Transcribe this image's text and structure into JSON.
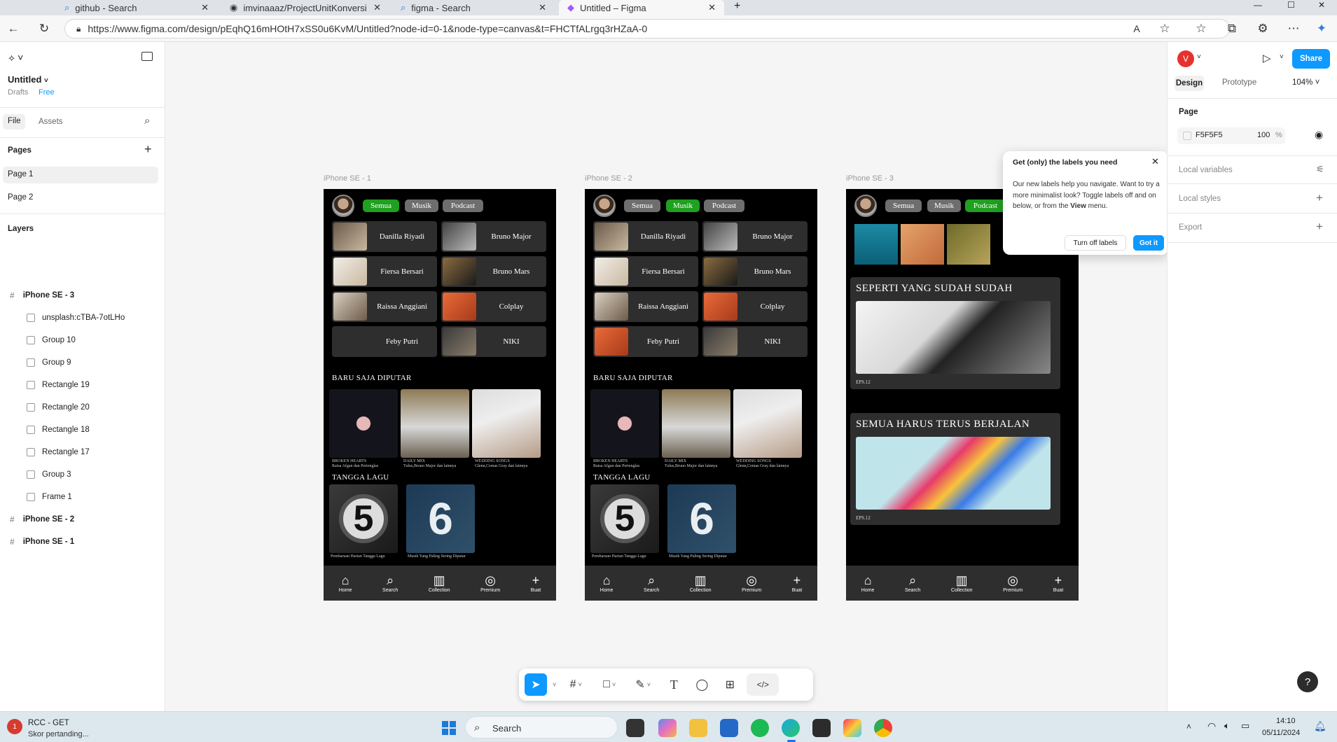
{
  "browser": {
    "tabs": [
      {
        "label": "github - Search"
      },
      {
        "label": "imvinaaaz/ProjectUnitKonversi"
      },
      {
        "label": "figma - Search"
      },
      {
        "label": "Untitled – Figma"
      }
    ],
    "url": "https://www.figma.com/design/pEqhQ16mHOtH7xSS0u6KvM/Untitled?node-id=0-1&node-type=canvas&t=FHCTfALrgq3rHZaA-0"
  },
  "file": {
    "name": "Untitled",
    "location": "Drafts",
    "plan": "Free"
  },
  "left": {
    "tabs": [
      "File",
      "Assets"
    ],
    "pages_title": "Pages",
    "pages": [
      "Page 1",
      "Page 2"
    ],
    "layers_title": "Layers",
    "layers": [
      {
        "name": "iPhone SE - 3",
        "bold": true
      },
      {
        "name": "unsplash:cTBA-7otLHo"
      },
      {
        "name": "Group 10"
      },
      {
        "name": "Group 9"
      },
      {
        "name": "Rectangle 19"
      },
      {
        "name": "Rectangle 20"
      },
      {
        "name": "Rectangle 18"
      },
      {
        "name": "Rectangle 17"
      },
      {
        "name": "Group 3"
      },
      {
        "name": "Frame 1"
      },
      {
        "name": "iPhone SE - 2",
        "bold": true
      },
      {
        "name": "iPhone SE - 1",
        "bold": true
      }
    ]
  },
  "right": {
    "avatar_letter": "V",
    "share": "Share",
    "tabs": [
      "Design",
      "Prototype"
    ],
    "zoom": "104%",
    "page_label": "Page",
    "page_color": "F5F5F5",
    "page_opacity": "100",
    "percent": "%",
    "sections": [
      "Local variables",
      "Local styles",
      "Export"
    ]
  },
  "frames": [
    {
      "label": "iPhone SE - 1",
      "active_chip": 0
    },
    {
      "label": "iPhone SE - 2",
      "active_chip": 1
    },
    {
      "label": "iPhone SE - 3",
      "active_chip": 2
    }
  ],
  "phone": {
    "chips": [
      "Semua",
      "Musik",
      "Podcast"
    ],
    "artists_v1": [
      "Danilla Riyadi",
      "Bruno Major",
      "Fiersa Bersari",
      "Bruno Mars",
      "Raissa Anggiani",
      "Colplay",
      "Feby Putri",
      "NIKI"
    ],
    "recent_title": "BARU SAJA DIPUTAR",
    "recent": [
      {
        "title": "BROKEN HEARTS",
        "sub": "Raisa Afgan dan Pertenglas"
      },
      {
        "title": "DAILY MIX",
        "sub": "Tulus,Bruno Major dan lainnya"
      },
      {
        "title": "WEDDING SONGS",
        "sub": "Glenn,Cemas Gray dan lainnya"
      }
    ],
    "charts_title": "TANGGA LAGU",
    "charts": [
      {
        "num": "5",
        "cap": "Pembaruan Harian Tangga Lagu"
      },
      {
        "num": "6",
        "cap": "Musik Yang Paling Sering Diputar"
      }
    ],
    "nav": [
      "Home",
      "Search",
      "Collection",
      "Premium",
      "Buat"
    ],
    "podcasts": [
      {
        "title": "SEPERTI YANG SUDAH SUDAH",
        "ep": "EPS.12"
      },
      {
        "title": "SEMUA HARUS TERUS BERJALAN",
        "ep": "EPS.12"
      }
    ]
  },
  "tooltip": {
    "title": "Get (only) the labels you need",
    "body": "Our new labels help you navigate. Want to try a more minimalist look? Toggle labels off and on below, or from the",
    "body_bold": "View",
    "body_end": "menu.",
    "secondary": "Turn off labels",
    "primary": "Got it"
  },
  "taskbar": {
    "notif_app": "RCC - GET",
    "notif_text": "Skor pertanding...",
    "search": "Search",
    "time": "14:10",
    "date": "05/11/2024"
  },
  "colors": {
    "accent": "#0d99ff",
    "chip_on": "#1fa01f",
    "chip_off": "#6e6e6e"
  }
}
